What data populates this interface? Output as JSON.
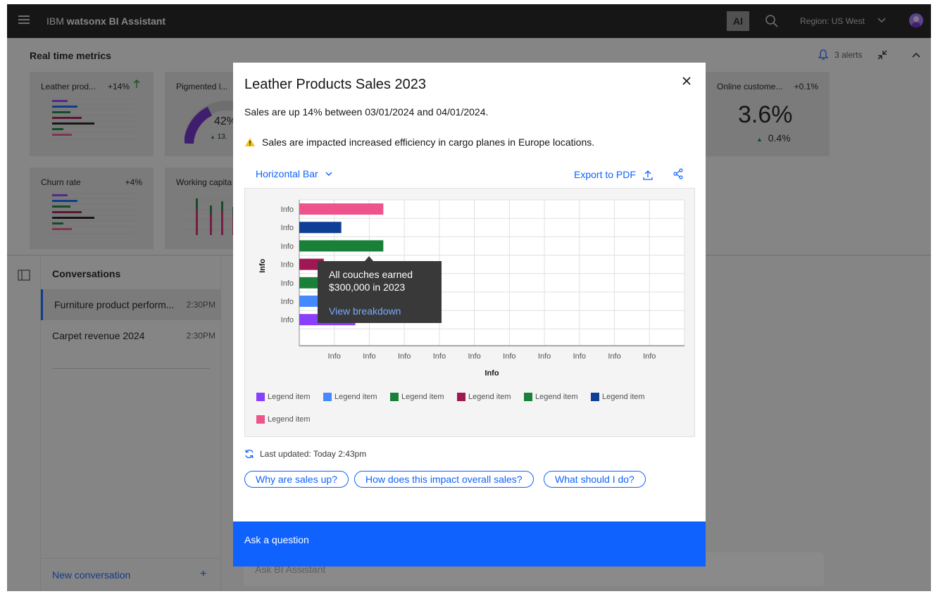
{
  "header": {
    "brand": "IBM",
    "product": "watsonx BI Assistant",
    "ai_badge": "AI",
    "region": "Region: US West"
  },
  "metrics": {
    "title": "Real time metrics",
    "alerts": "3 alerts",
    "tiles": [
      {
        "label": "Leather prod...",
        "value": "+14%"
      },
      {
        "label": "Pigmented l...",
        "gauge_text": "42%",
        "sub": "13."
      },
      {
        "label": "Online custome...",
        "value": "+0.1%",
        "big": "3.6%",
        "sub": "0.4%"
      },
      {
        "label": "Churn rate",
        "value": "+4%"
      },
      {
        "label": "Working capita"
      }
    ]
  },
  "conversations": {
    "title": "Conversations",
    "items": [
      {
        "name": "Furniture product perform...",
        "time": "2:30PM"
      },
      {
        "name": "Carpet revenue 2024",
        "time": "2:30PM"
      }
    ],
    "new_label": "New conversation",
    "new_icon": "+"
  },
  "background_input": {
    "placeholder": "Ask BI Assistant"
  },
  "modal": {
    "title": "Leather Products Sales 2023",
    "summary": "Sales are up 14% between 03/01/2024 and 04/01/2024.",
    "warning": "Sales are impacted increased efficiency in cargo planes in Europe locations.",
    "chart_type": "Horizontal Bar",
    "export_label": "Export to PDF",
    "tooltip": {
      "text": "All couches earned $300,000 in 2023",
      "link": "View breakdown"
    },
    "updated": "Last updated: Today 2:43pm",
    "chips": [
      "Why are sales up?",
      "How does this impact overall sales?",
      "What should I do?"
    ],
    "ask_label": "Ask a question"
  },
  "colors": {
    "accent": "#0f62fe",
    "purple": "#8a3ffc",
    "blue": "#1192e8",
    "green": "#198038",
    "maroon": "#9f1853",
    "navy": "#012749",
    "pink": "#ee538b",
    "warning": "#f1c21b"
  },
  "chart_data": {
    "type": "bar",
    "orientation": "horizontal",
    "title": "",
    "xlabel": "Info",
    "ylabel": "Info",
    "categories": [
      "Info",
      "Info",
      "Info",
      "Info",
      "Info",
      "Info",
      "Info"
    ],
    "x_ticks": [
      "Info",
      "Info",
      "Info",
      "Info",
      "Info",
      "Info",
      "Info",
      "Info",
      "Info",
      "Info"
    ],
    "xlim": [
      0,
      11
    ],
    "grid": true,
    "legend_position": "bottom",
    "series": [
      {
        "name": "Legend item",
        "color": "#ee538b",
        "value": 2.4
      },
      {
        "name": "Legend item",
        "color": "#0f3e96",
        "value": 1.2
      },
      {
        "name": "Legend item",
        "color": "#198038",
        "value": 2.4
      },
      {
        "name": "Legend item",
        "color": "#9f1853",
        "value": 0.7
      },
      {
        "name": "Legend item",
        "color": "#198038",
        "value": 0.7
      },
      {
        "name": "Legend item",
        "color": "#4589ff",
        "value": 0.7
      },
      {
        "name": "Legend item",
        "color": "#8a3ffc",
        "value": 1.6
      }
    ],
    "legend": [
      {
        "label": "Legend item",
        "color": "#8a3ffc"
      },
      {
        "label": "Legend item",
        "color": "#4589ff"
      },
      {
        "label": "Legend item",
        "color": "#198038"
      },
      {
        "label": "Legend item",
        "color": "#9f1853"
      },
      {
        "label": "Legend item",
        "color": "#198038"
      },
      {
        "label": "Legend item",
        "color": "#0f3e96"
      },
      {
        "label": "Legend item",
        "color": "#ee538b"
      }
    ]
  }
}
